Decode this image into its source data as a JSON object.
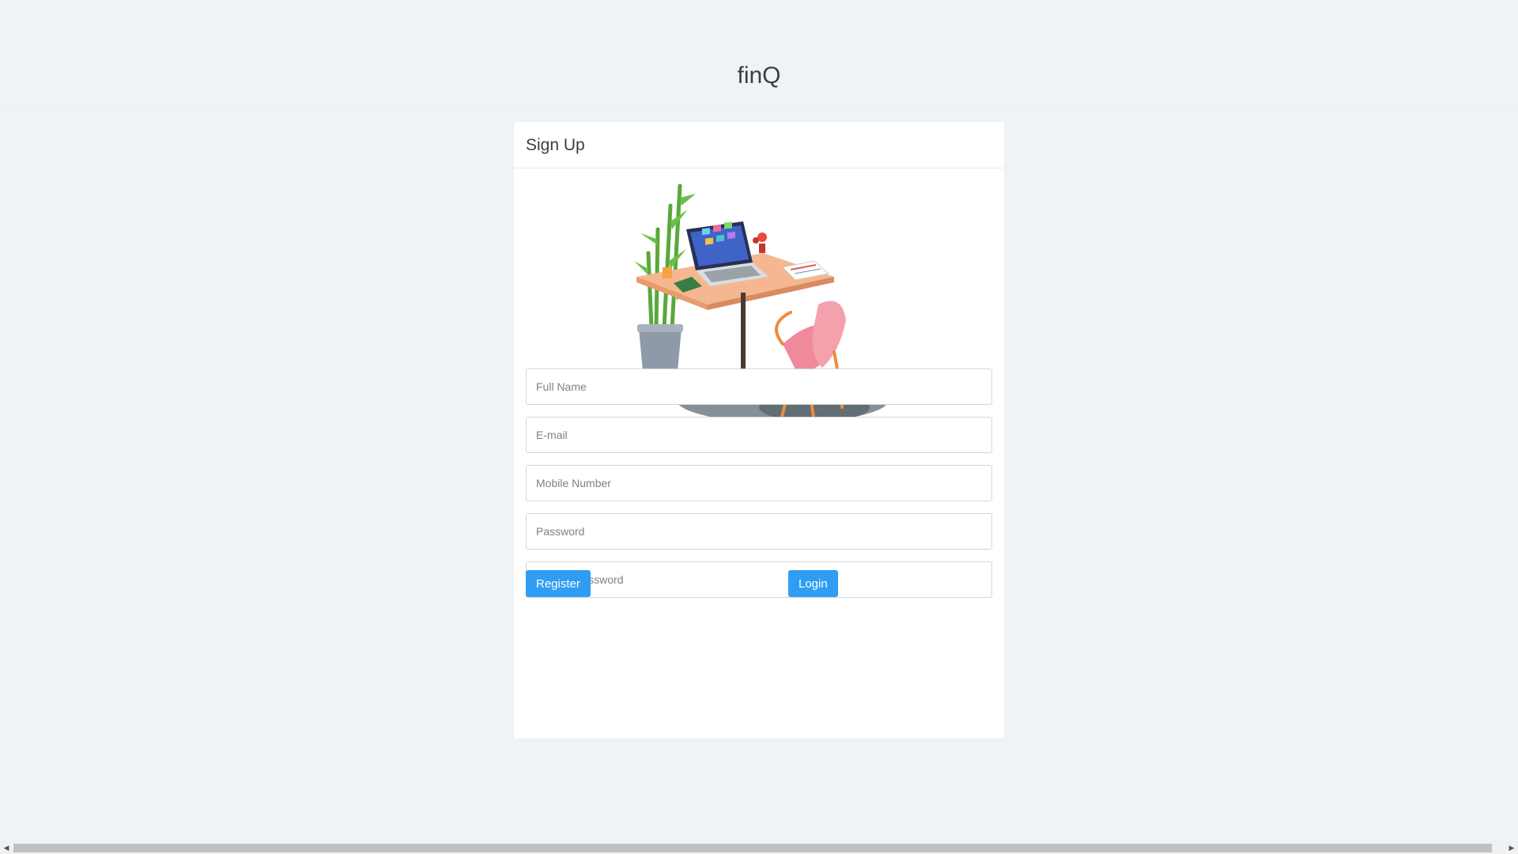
{
  "app": {
    "brand": "finQ"
  },
  "signup": {
    "title": "Sign Up",
    "fields": {
      "full_name_placeholder": "Full Name",
      "email_placeholder": "E-mail",
      "mobile_placeholder": "Mobile Number",
      "password_placeholder": "Password",
      "repeat_password_placeholder": "Repeat Password"
    },
    "buttons": {
      "register_label": "Register",
      "login_label": "Login"
    }
  },
  "colors": {
    "page_background": "#f0f3f6",
    "primary_button": "#2f9df3"
  },
  "icons": {
    "scroll_left": "scroll-left-arrow-icon",
    "scroll_right": "scroll-right-arrow-icon"
  }
}
